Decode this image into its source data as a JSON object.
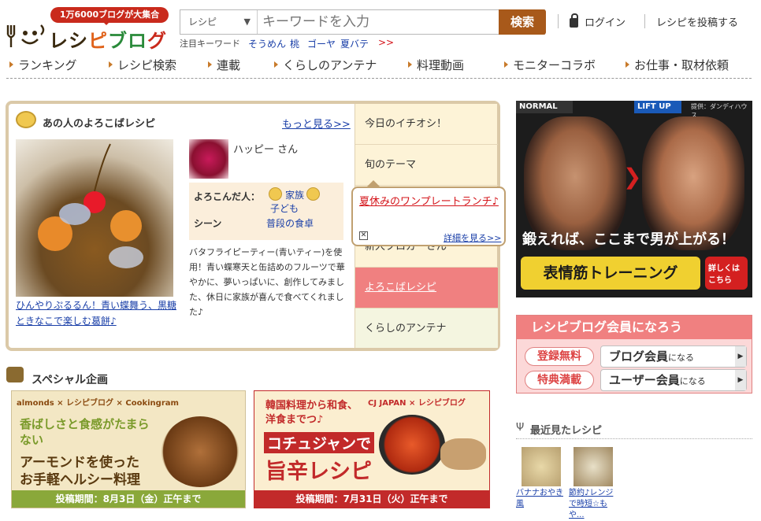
{
  "header": {
    "logo_badge": "1万6000ブログが大集合",
    "logo_text_1": "レシ",
    "logo_text_2": "ピ",
    "logo_text_3": "ブロ",
    "logo_text_4": "グ",
    "search": {
      "category": "レシピ",
      "placeholder": "キーワードを入力",
      "button": "検索"
    },
    "login": "ログイン",
    "post": "レシピを投稿する",
    "keywords_label": "注目キーワード",
    "keywords": [
      "そうめん",
      "桃",
      "ゴーヤ",
      "夏バテ",
      ">>"
    ]
  },
  "nav": [
    "ランキング",
    "レシピ検索",
    "連載",
    "くらしのアンテナ",
    "料理動画",
    "モニターコラボ",
    "お仕事・取材依頼"
  ],
  "feature": {
    "title": "あの人のよろこばレシピ",
    "more": "もっと見る>>",
    "caption": "ひんやりぷるるん！青い蝶舞う、黒糖ときなこで楽しむ葛餅♪",
    "user": "ハッピー さん",
    "info": {
      "who_label": "よろこんだ人：",
      "who_1": "家族",
      "who_2": "子ども",
      "scene_label": "シーン",
      "scene": "普段の食卓"
    },
    "description": "バタフライピーティー(青いティー)を使用！青い蝶寒天と缶詰めのフルーツで華やかに、夢いっぱいに、創作してみました、休日に家族が喜んで食べてくれました♪"
  },
  "tabs": [
    "今日のイチオシ！",
    "旬のテーマ",
    "新人ブロガーさん",
    "よろこばレシピ",
    "くらしのアンテナ"
  ],
  "popup": {
    "title": "夏休みのワンプレートランチ♪",
    "close": "✕",
    "link": "詳細を見る>>"
  },
  "special": {
    "title": "スペシャル企画",
    "banner1": {
      "brand": "almonds × レシピブログ × Cookingram",
      "line1": "香ばしさと食感がたまらない",
      "line2": "アーモンドを使った",
      "line3": "お手軽ヘルシー料理",
      "period": "投稿期間：8月3日（金）正午まで"
    },
    "banner2": {
      "brand": "CJ JAPAN × レシピブログ",
      "line1": "韓国料理から和食、洋食までつ♪",
      "line2": "コチュジャンで",
      "line3": "旨辛レシピ",
      "period": "投稿期間：7月31日（火）正午まで"
    }
  },
  "ad": {
    "normal": "NORMAL",
    "liftup": "LIFT UP",
    "sponsor": "提供：ダンディハウス",
    "headline": "鍛えれば、ここまで男が上がる！",
    "product": "表情筋トレーニング",
    "cta": "詳しくはこちら"
  },
  "member": {
    "head": "レシピブログ会員になろう",
    "tag1": "登録無料",
    "tag2": "特典満載",
    "btn1": "ブログ会員",
    "btn1_sub": "になる",
    "btn2": "ユーザー会員",
    "btn2_sub": "になる"
  },
  "recent": {
    "title": "最近見たレシピ",
    "items": [
      "バナナおやき風",
      "節約♪レンジで時短☆もや..."
    ]
  },
  "colors": {
    "accent": "#a8591a",
    "brand_red": "#c92a1c",
    "tab_active": "#f08080"
  }
}
